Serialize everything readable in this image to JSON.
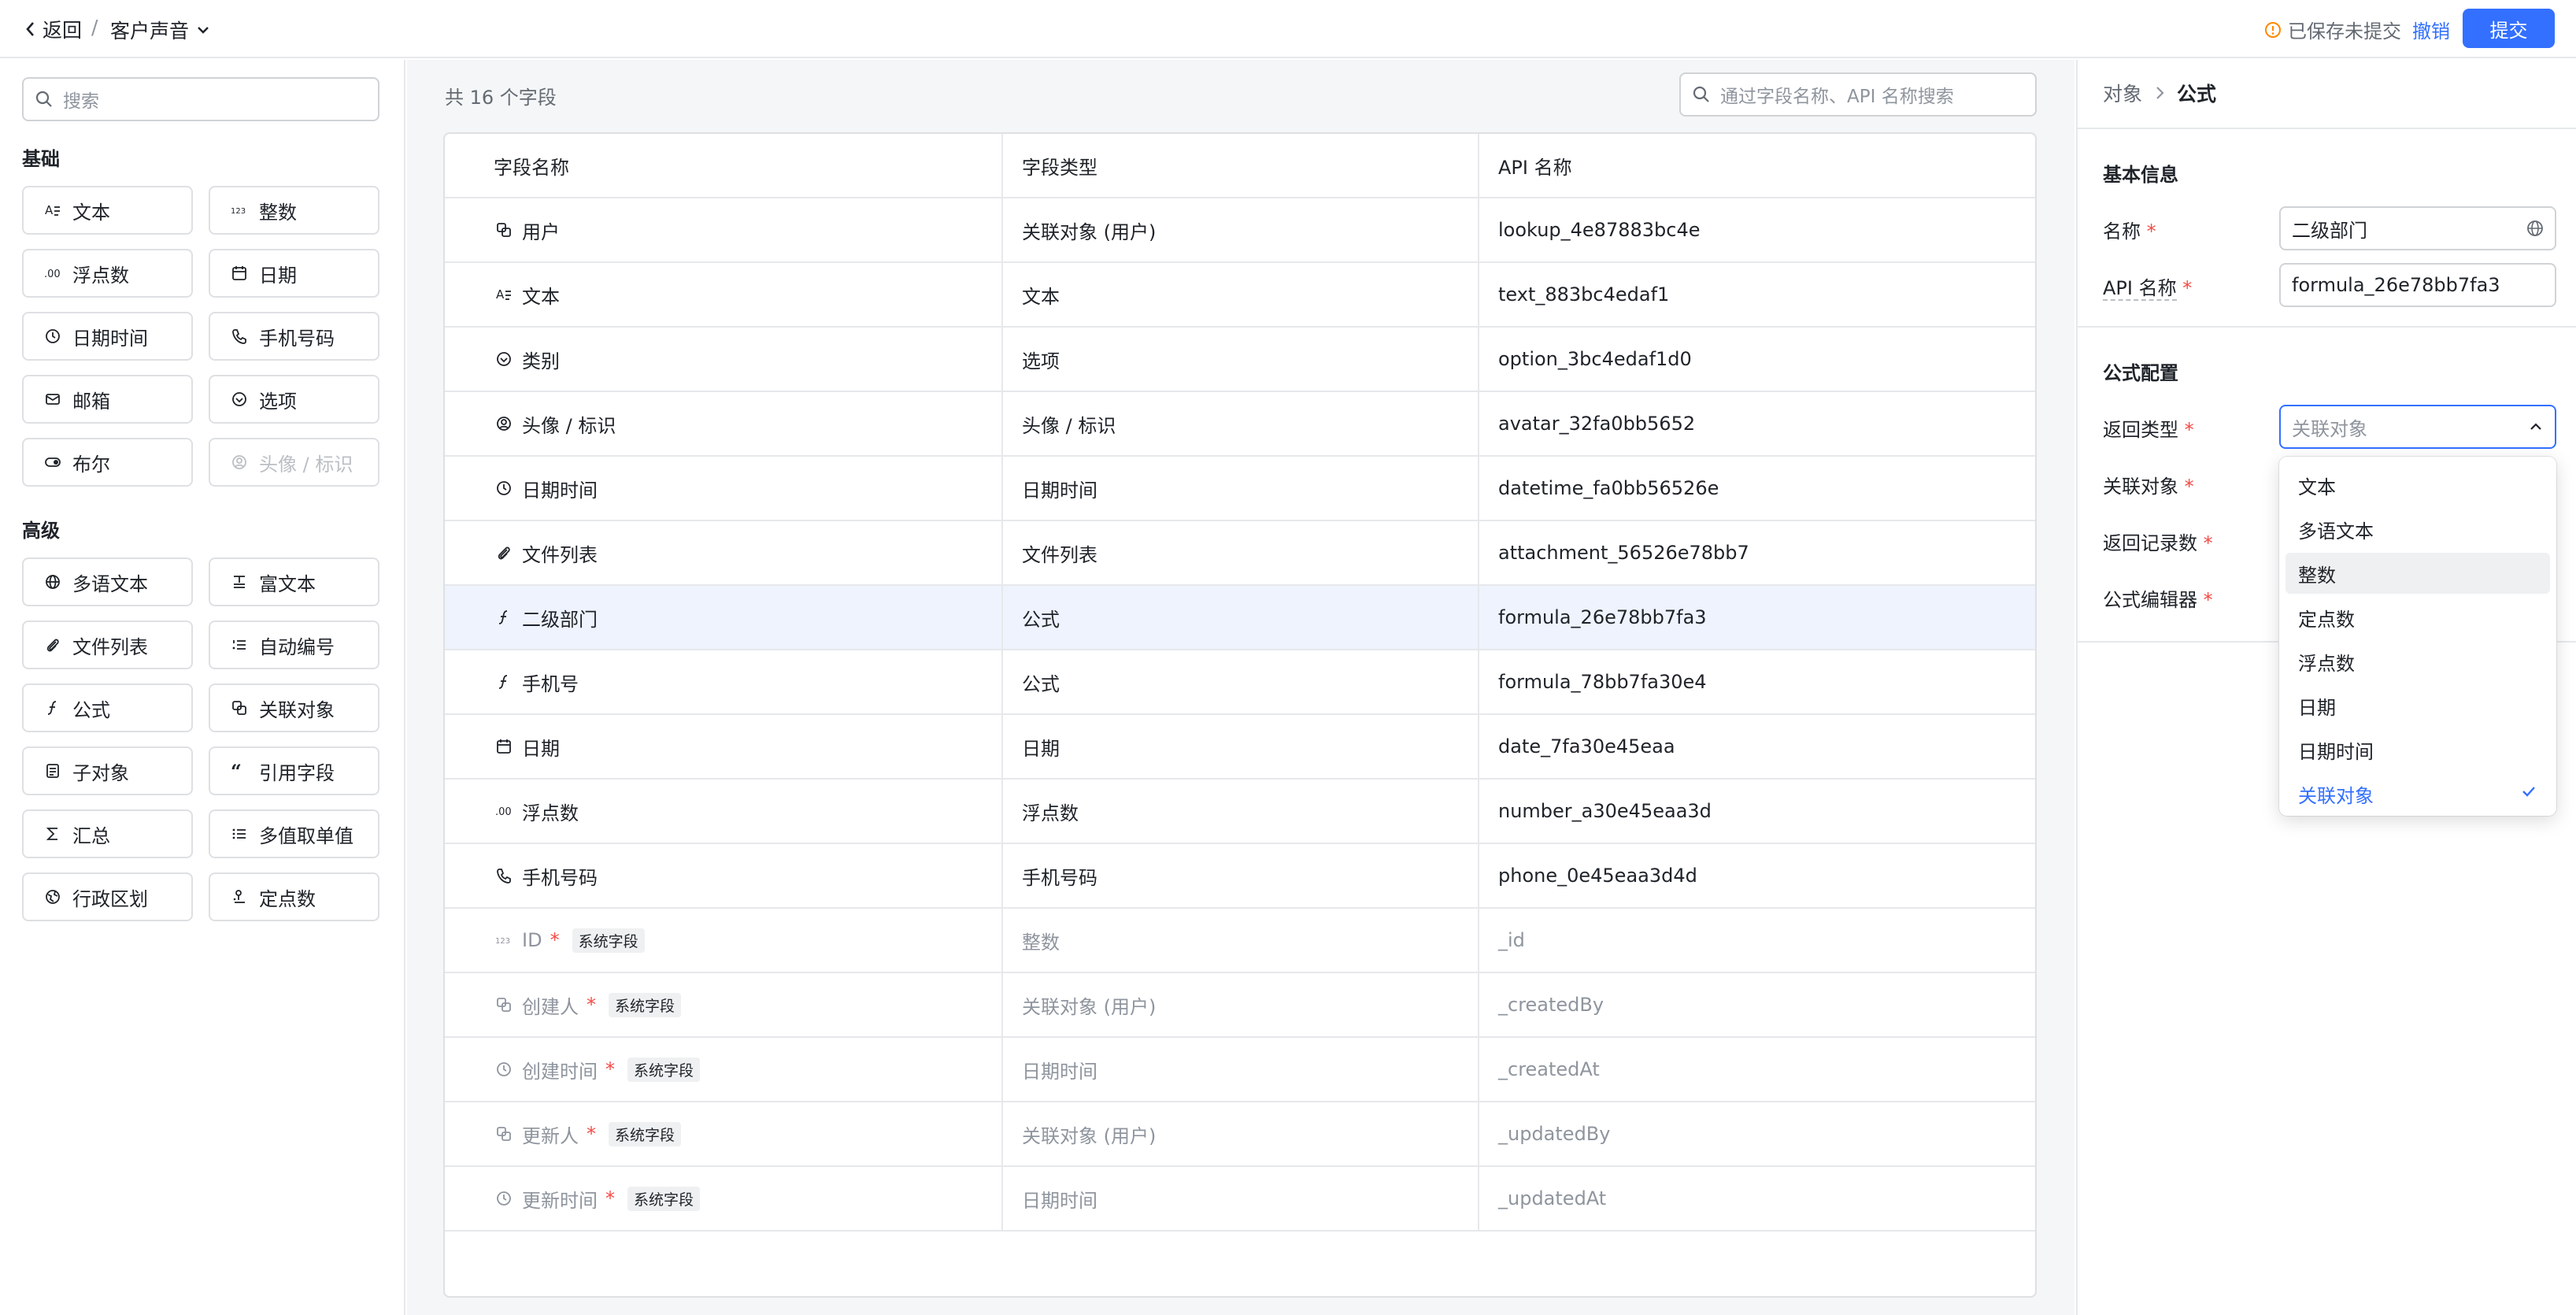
{
  "topbar": {
    "back_label": "返回",
    "separator": "/",
    "app_title": "客户声音",
    "status_text": "已保存未提交",
    "cancel_label": "撤销",
    "submit_label": "提交"
  },
  "sidebar": {
    "search_placeholder": "搜索",
    "basic_title": "基础",
    "basic_items": [
      {
        "label": "文本",
        "icon": "text-icon"
      },
      {
        "label": "整数",
        "icon": "integer-icon"
      },
      {
        "label": "浮点数",
        "icon": "float-icon"
      },
      {
        "label": "日期",
        "icon": "calendar-icon"
      },
      {
        "label": "日期时间",
        "icon": "clock-icon"
      },
      {
        "label": "手机号码",
        "icon": "phone-icon"
      },
      {
        "label": "邮箱",
        "icon": "mail-icon"
      },
      {
        "label": "选项",
        "icon": "option-icon"
      },
      {
        "label": "布尔",
        "icon": "toggle-icon"
      },
      {
        "label": "头像 / 标识",
        "icon": "avatar-icon",
        "disabled": true
      }
    ],
    "advanced_title": "高级",
    "advanced_items": [
      {
        "label": "多语文本",
        "icon": "globe-icon"
      },
      {
        "label": "富文本",
        "icon": "richtext-icon"
      },
      {
        "label": "文件列表",
        "icon": "attachment-icon"
      },
      {
        "label": "自动编号",
        "icon": "numbered-list-icon"
      },
      {
        "label": "公式",
        "icon": "formula-icon"
      },
      {
        "label": "关联对象",
        "icon": "lookup-icon"
      },
      {
        "label": "子对象",
        "icon": "subobject-icon"
      },
      {
        "label": "引用字段",
        "icon": "quote-icon"
      },
      {
        "label": "汇总",
        "icon": "sigma-icon"
      },
      {
        "label": "多值取单值",
        "icon": "list-icon"
      },
      {
        "label": "行政区划",
        "icon": "region-icon"
      },
      {
        "label": "定点数",
        "icon": "decimal-icon"
      }
    ]
  },
  "main": {
    "count_text": "共 16 个字段",
    "search_placeholder": "通过字段名称、API 名称搜索",
    "columns": [
      "字段名称",
      "字段类型",
      "API 名称"
    ],
    "rows": [
      {
        "name": "用户",
        "type": "关联对象 (用户)",
        "api": "lookup_4e87883bc4e",
        "icon": "lookup-icon"
      },
      {
        "name": "文本",
        "type": "文本",
        "api": "text_883bc4edaf1",
        "icon": "text-icon"
      },
      {
        "name": "类别",
        "type": "选项",
        "api": "option_3bc4edaf1d0",
        "icon": "option-icon"
      },
      {
        "name": "头像 / 标识",
        "type": "头像 / 标识",
        "api": "avatar_32fa0bb5652",
        "icon": "avatar-icon"
      },
      {
        "name": "日期时间",
        "type": "日期时间",
        "api": "datetime_fa0bb56526e",
        "icon": "clock-icon"
      },
      {
        "name": "文件列表",
        "type": "文件列表",
        "api": "attachment_56526e78bb7",
        "icon": "attachment-icon"
      },
      {
        "name": "二级部门",
        "type": "公式",
        "api": "formula_26e78bb7fa3",
        "icon": "formula-icon",
        "selected": true
      },
      {
        "name": "手机号",
        "type": "公式",
        "api": "formula_78bb7fa30e4",
        "icon": "formula-icon"
      },
      {
        "name": "日期",
        "type": "日期",
        "api": "date_7fa30e45eaa",
        "icon": "calendar-icon"
      },
      {
        "name": "浮点数",
        "type": "浮点数",
        "api": "number_a30e45eaa3d",
        "icon": "float-icon"
      },
      {
        "name": "手机号码",
        "type": "手机号码",
        "api": "phone_0e45eaa3d4d",
        "icon": "phone-icon"
      },
      {
        "name": "ID",
        "type": "整数",
        "api": "_id",
        "icon": "integer-icon",
        "system": true
      },
      {
        "name": "创建人",
        "type": "关联对象 (用户)",
        "api": "_createdBy",
        "icon": "lookup-icon",
        "system": true
      },
      {
        "name": "创建时间",
        "type": "日期时间",
        "api": "_createdAt",
        "icon": "clock-icon",
        "system": true
      },
      {
        "name": "更新人",
        "type": "关联对象 (用户)",
        "api": "_updatedBy",
        "icon": "lookup-icon",
        "system": true
      },
      {
        "name": "更新时间",
        "type": "日期时间",
        "api": "_updatedAt",
        "icon": "clock-icon",
        "system": true
      }
    ],
    "required_mark": "*",
    "system_badge": "系统字段"
  },
  "panel": {
    "breadcrumb_parent": "对象",
    "breadcrumb_current": "公式",
    "basic_section": "基本信息",
    "name_label": "名称",
    "name_value": "二级部门",
    "api_label": "API 名称",
    "api_value": "formula_26e78bb7fa3",
    "formula_section": "公式配置",
    "return_type_label": "返回类型",
    "return_type_value": "关联对象",
    "lookup_label": "关联对象",
    "return_count_label": "返回记录数",
    "editor_label": "公式编辑器",
    "required_mark": "*"
  },
  "dropdown": {
    "options": [
      "文本",
      "多语文本",
      "整数",
      "定点数",
      "浮点数",
      "日期",
      "日期时间",
      "关联对象"
    ],
    "hover_index": 2,
    "selected_index": 7
  },
  "colors": {
    "accent": "#3370ff",
    "required": "#f54a45",
    "selected_row": "#eef3fe",
    "warning": "#ff8800"
  }
}
